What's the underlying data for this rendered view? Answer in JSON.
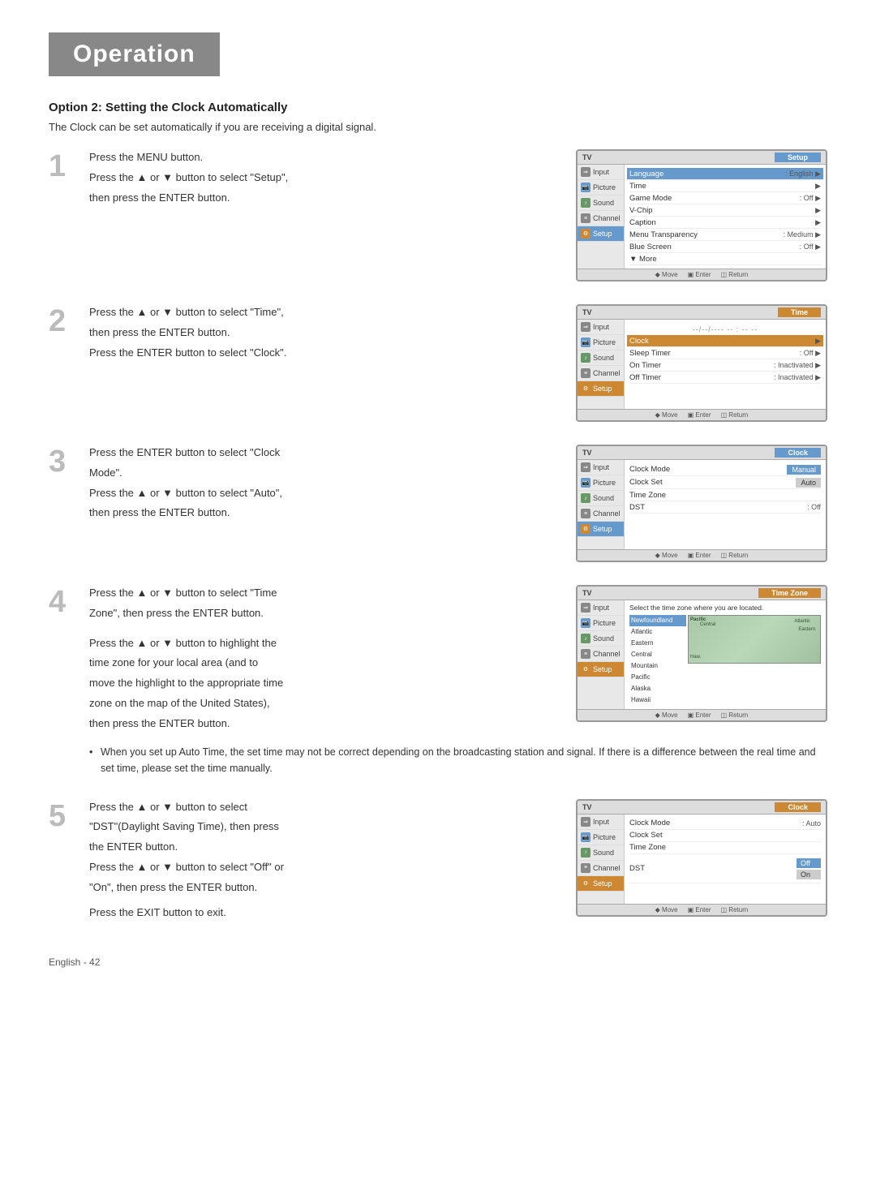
{
  "page": {
    "title": "Operation",
    "footer": "English - 42"
  },
  "section": {
    "title": "Option 2: Setting the Clock Automatically",
    "intro": "The Clock can be set automatically if you are receiving a digital signal."
  },
  "steps": [
    {
      "number": "1",
      "lines": [
        "Press the MENU button.",
        "Press the ▲ or ▼ button to select \"Setup\",",
        "then press the ENTER button."
      ],
      "screen": {
        "label": "TV",
        "menu_title": "Setup",
        "menu_color": "blue",
        "sidebar": [
          {
            "label": "Input",
            "icon": "input",
            "active": false
          },
          {
            "label": "Picture",
            "icon": "picture",
            "active": false
          },
          {
            "label": "Sound",
            "icon": "sound",
            "active": false
          },
          {
            "label": "Channel",
            "icon": "channel",
            "active": false
          },
          {
            "label": "Setup",
            "icon": "setup",
            "active": true
          }
        ],
        "items": [
          {
            "label": "Language",
            "value": ": English",
            "arrow": true,
            "highlighted": true
          },
          {
            "label": "Time",
            "value": "",
            "arrow": true
          },
          {
            "label": "Game Mode",
            "value": ": Off",
            "arrow": true
          },
          {
            "label": "V-Chip",
            "value": "",
            "arrow": true
          },
          {
            "label": "Caption",
            "value": "",
            "arrow": true
          },
          {
            "label": "Menu Transparency",
            "value": ": Medium",
            "arrow": true
          },
          {
            "label": "Blue Screen",
            "value": ": Off",
            "arrow": true
          },
          {
            "label": "▼ More",
            "value": "",
            "arrow": false
          }
        ]
      }
    },
    {
      "number": "2",
      "lines": [
        "Press the ▲ or ▼ button to select \"Time\",",
        "then press the ENTER button.",
        "Press the ENTER button to select \"Clock\"."
      ],
      "screen": {
        "label": "TV",
        "menu_title": "Time",
        "menu_color": "orange",
        "sidebar": [
          {
            "label": "Input",
            "icon": "input",
            "active": false
          },
          {
            "label": "Picture",
            "icon": "picture",
            "active": false
          },
          {
            "label": "Sound",
            "icon": "sound",
            "active": false
          },
          {
            "label": "Channel",
            "icon": "channel",
            "active": false
          },
          {
            "label": "Setup",
            "icon": "setup",
            "active": true
          }
        ],
        "clock_header": "--/--/---- -- : -- --",
        "items": [
          {
            "label": "Clock",
            "value": "",
            "arrow": true,
            "highlighted": true
          },
          {
            "label": "Sleep Timer",
            "value": ": Off",
            "arrow": true
          },
          {
            "label": "On Timer",
            "value": ": Inactivated",
            "arrow": true
          },
          {
            "label": "Off Timer",
            "value": ": Inactivated",
            "arrow": true
          }
        ]
      }
    },
    {
      "number": "3",
      "lines": [
        "Press the ENTER button to select \"Clock",
        "Mode\".",
        "Press the ▲ or ▼ button to select \"Auto\",",
        "then press the ENTER button."
      ],
      "screen": {
        "label": "TV",
        "menu_title": "Clock",
        "menu_color": "blue",
        "sidebar": [
          {
            "label": "Input",
            "icon": "input",
            "active": false
          },
          {
            "label": "Picture",
            "icon": "picture",
            "active": false
          },
          {
            "label": "Sound",
            "icon": "sound",
            "active": false
          },
          {
            "label": "Channel",
            "icon": "channel",
            "active": false
          },
          {
            "label": "Setup",
            "icon": "setup",
            "active": true
          }
        ],
        "items": [
          {
            "label": "Clock Mode",
            "value": "Manual",
            "highlighted_value": true
          },
          {
            "label": "Clock Set",
            "value": "Auto",
            "dim_value": true
          },
          {
            "label": "Time Zone",
            "value": "",
            "arrow": false
          },
          {
            "label": "DST",
            "value": ": Off",
            "arrow": false
          }
        ]
      }
    },
    {
      "number": "4",
      "lines": [
        "Press the ▲ or ▼ button to select \"Time",
        "Zone\", then press the ENTER button."
      ],
      "extra_lines": [
        "Press the ▲ or ▼ button to highlight the",
        "time zone for your local area (and to",
        "move the highlight to the appropriate time",
        "zone on the map of the United States),",
        "then press the ENTER button."
      ],
      "bullet": "When you set up Auto Time, the set time may not be correct depending on the broadcasting station and signal. If there is a difference between the real time and set time, please set the time manually.",
      "screen": {
        "label": "TV",
        "menu_title": "Time Zone",
        "menu_color": "orange",
        "sidebar": [
          {
            "label": "Input",
            "icon": "input",
            "active": false
          },
          {
            "label": "Picture",
            "icon": "picture",
            "active": false
          },
          {
            "label": "Sound",
            "icon": "sound",
            "active": false
          },
          {
            "label": "Channel",
            "icon": "channel",
            "active": false
          },
          {
            "label": "Setup",
            "icon": "setup",
            "active": true
          }
        ],
        "timezone_intro": "Select the time zone where you are located.",
        "timezones": [
          {
            "label": "Newfoundland",
            "selected": true
          },
          {
            "label": "Atlantic",
            "selected": false
          },
          {
            "label": "Eastern",
            "selected": false
          },
          {
            "label": "Central",
            "selected": false
          },
          {
            "label": "Mountain",
            "selected": false
          },
          {
            "label": "Pacific",
            "selected": false
          },
          {
            "label": "Alaska",
            "selected": false
          },
          {
            "label": "Hawaii",
            "selected": false
          }
        ]
      }
    },
    {
      "number": "5",
      "lines": [
        "Press the ▲ or ▼ button to select",
        "\"DST\"(Daylight Saving Time), then press",
        "the ENTER button.",
        "Press the ▲ or ▼ button to select \"Off\" or",
        "\"On\", then press the ENTER button."
      ],
      "extra_lines": [
        "Press the EXIT button to exit."
      ],
      "screen": {
        "label": "TV",
        "menu_title": "Clock",
        "menu_color": "orange",
        "sidebar": [
          {
            "label": "Input",
            "icon": "input",
            "active": false
          },
          {
            "label": "Picture",
            "icon": "picture",
            "active": false
          },
          {
            "label": "Sound",
            "icon": "sound",
            "active": false
          },
          {
            "label": "Channel",
            "icon": "channel",
            "active": false
          },
          {
            "label": "Setup",
            "icon": "setup",
            "active": true
          }
        ],
        "items": [
          {
            "label": "Clock Mode",
            "value": ": Auto"
          },
          {
            "label": "Clock Set",
            "value": ""
          },
          {
            "label": "Time Zone",
            "value": ""
          },
          {
            "label": "DST",
            "value": "",
            "has_dst_options": true
          }
        ],
        "dst_options": [
          "Off",
          "On"
        ]
      }
    }
  ],
  "ui": {
    "bottom_bar": {
      "move": "◆ Move",
      "enter": "▣ Enter",
      "return": "◫ Return"
    },
    "sidebar_labels": {
      "input": "Input",
      "picture": "Picture",
      "sound": "Sound",
      "channel": "Channel",
      "setup": "Setup"
    }
  }
}
